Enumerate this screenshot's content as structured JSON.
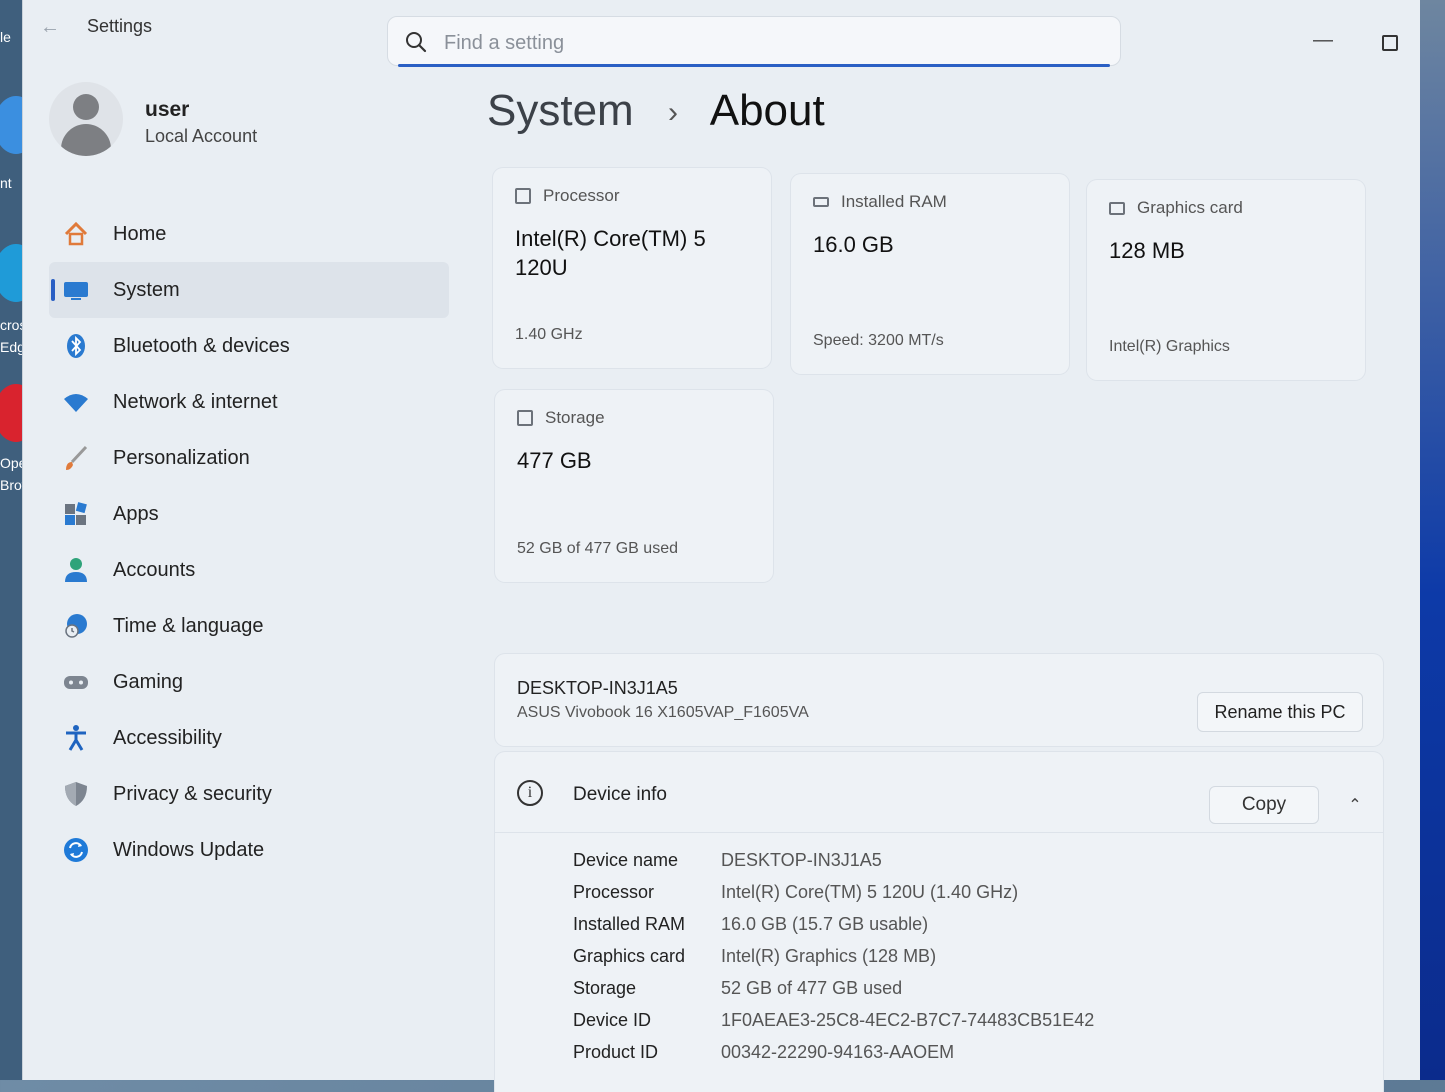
{
  "window": {
    "title": "Settings",
    "min_glyph": "—"
  },
  "search": {
    "placeholder": "Find a setting"
  },
  "profile": {
    "name": "user",
    "account_type": "Local Account"
  },
  "nav": {
    "items": [
      {
        "label": "Home",
        "icon": "home-icon"
      },
      {
        "label": "System",
        "icon": "system-icon",
        "active": true
      },
      {
        "label": "Bluetooth & devices",
        "icon": "bluetooth-icon"
      },
      {
        "label": "Network & internet",
        "icon": "wifi-icon"
      },
      {
        "label": "Personalization",
        "icon": "brush-icon"
      },
      {
        "label": "Apps",
        "icon": "apps-icon"
      },
      {
        "label": "Accounts",
        "icon": "accounts-icon"
      },
      {
        "label": "Time & language",
        "icon": "globe-clock-icon"
      },
      {
        "label": "Gaming",
        "icon": "gamepad-icon"
      },
      {
        "label": "Accessibility",
        "icon": "accessibility-icon"
      },
      {
        "label": "Privacy & security",
        "icon": "shield-icon"
      },
      {
        "label": "Windows Update",
        "icon": "update-icon"
      }
    ]
  },
  "breadcrumb": {
    "parent": "System",
    "separator": "›",
    "current": "About"
  },
  "specs": {
    "processor": {
      "label": "Processor",
      "value": "Intel(R) Core(TM) 5 120U",
      "sub": "1.40 GHz"
    },
    "ram": {
      "label": "Installed RAM",
      "value": "16.0 GB",
      "sub": "Speed: 3200 MT/s"
    },
    "graphics": {
      "label": "Graphics card",
      "value": "128 MB",
      "sub": "Intel(R) Graphics"
    },
    "storage": {
      "label": "Storage",
      "value": "477 GB",
      "sub": "52 GB of 477 GB used"
    }
  },
  "pc": {
    "name": "DESKTOP-IN3J1A5",
    "model": "ASUS Vivobook 16 X1605VAP_F1605VA",
    "rename_label": "Rename this PC"
  },
  "device_info": {
    "title": "Device info",
    "copy_label": "Copy",
    "rows": [
      {
        "key": "Device name",
        "value": "DESKTOP-IN3J1A5"
      },
      {
        "key": "Processor",
        "value": "Intel(R) Core(TM) 5 120U (1.40 GHz)"
      },
      {
        "key": "Installed RAM",
        "value": "16.0 GB (15.7 GB usable)"
      },
      {
        "key": "Graphics card",
        "value": "Intel(R) Graphics (128 MB)"
      },
      {
        "key": "Storage",
        "value": "52 GB of 477 GB used"
      },
      {
        "key": "Device ID",
        "value": "1F0AEAE3-25C8-4EC2-B7C7-74483CB51E42"
      },
      {
        "key": "Product ID",
        "value": "00342-22290-94163-AAOEM"
      }
    ]
  },
  "desktop": {
    "icons": [
      "le",
      "nt",
      "cros",
      "Edge",
      "Oper",
      "Brows"
    ]
  },
  "colors": {
    "accent": "#2a5fc4",
    "window_bg": "#e9eef3",
    "card_bg": "#eef2f6"
  }
}
